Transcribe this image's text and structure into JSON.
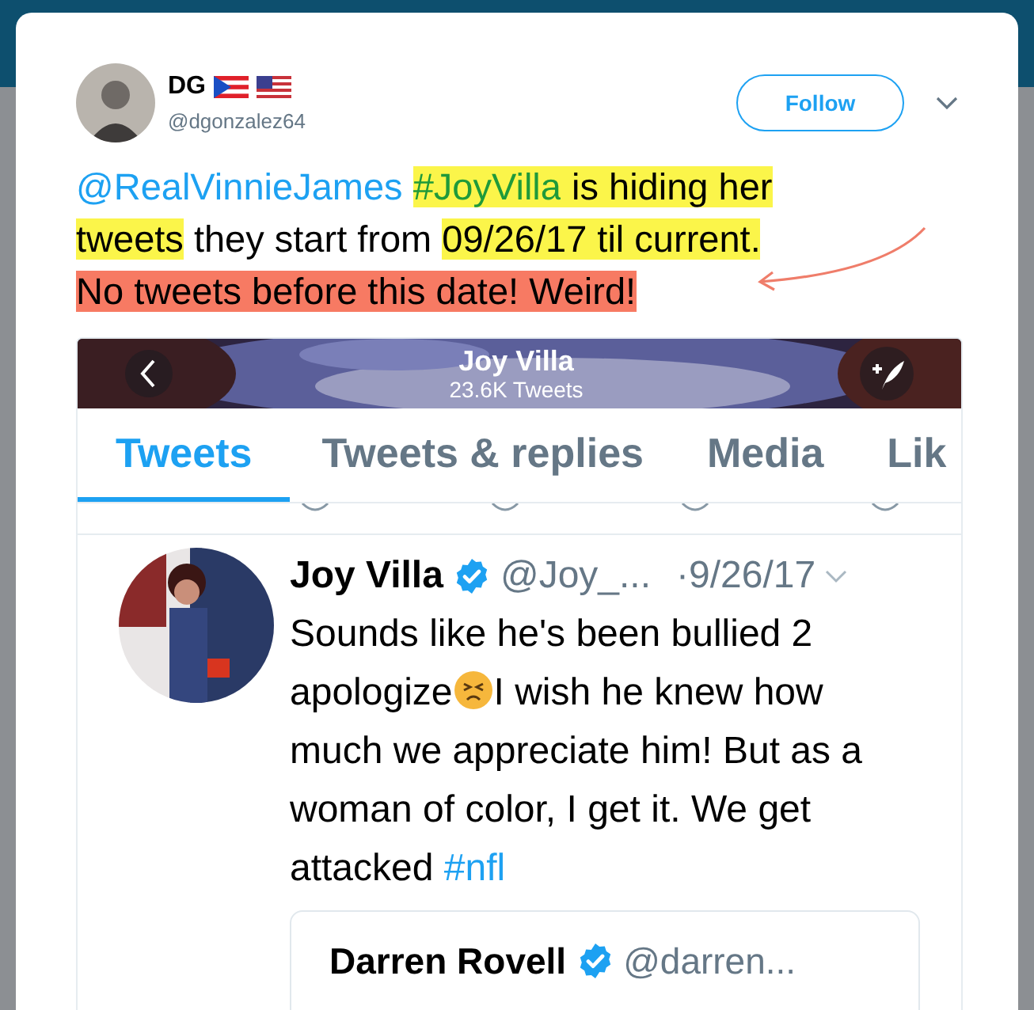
{
  "tweet": {
    "name": "DG",
    "handle": "@dgonzalez64",
    "follow_label": "Follow",
    "lines": [
      [
        {
          "kind": "mention",
          "text": "@RealVinnieJames "
        },
        {
          "kind": "hashtag",
          "text": "#JoyVilla",
          "color": "#fbf54a"
        },
        {
          "kind": "plain",
          "text": " is hiding her",
          "color": "#fbf54a"
        }
      ],
      [
        {
          "kind": "plain",
          "text": "tweets",
          "color": "#fbf54a"
        },
        {
          "kind": "plain",
          "text": " they start from "
        },
        {
          "kind": "plain",
          "text": "09/26/17 til current.",
          "color": "#fbf54a"
        }
      ],
      [
        {
          "kind": "plain",
          "text": "No tweets before this date! Weird!",
          "color": "#f77a63"
        }
      ]
    ]
  },
  "screenshot": {
    "title": "Joy Villa",
    "subtitle": "23.6K Tweets",
    "tabs": [
      {
        "label": "Tweets",
        "selected": true
      },
      {
        "label": "Tweets & replies",
        "selected": false
      },
      {
        "label": "Media",
        "selected": false
      },
      {
        "label": "Lik",
        "selected": false
      }
    ],
    "post": {
      "name": "Joy Villa",
      "verified": true,
      "handle": "@Joy_...",
      "date": "·9/26/17",
      "text_before": "Sounds like he's been bullied 2 apologize",
      "text_after": "I wish he knew how much we appreciate him! But as a woman of color, I get it. We get attacked ",
      "hashtag": "#nfl",
      "quote": {
        "name": "Darren Rovell",
        "verified": true,
        "handle": "@darren..."
      }
    }
  }
}
